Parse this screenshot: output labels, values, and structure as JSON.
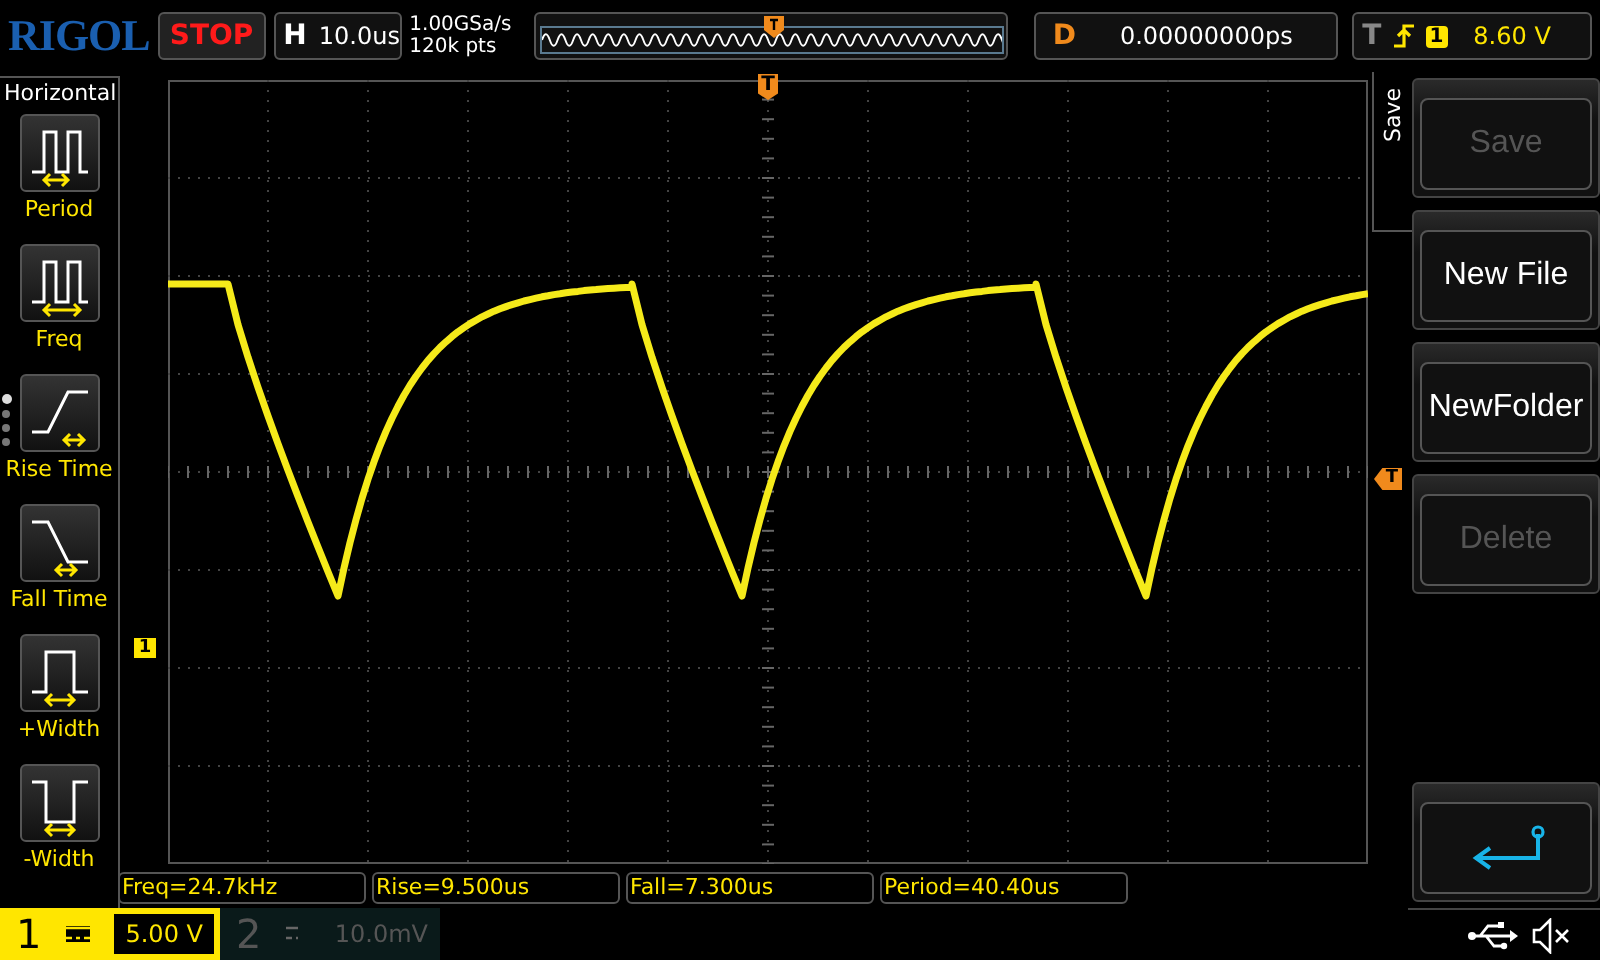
{
  "header": {
    "logo": "RIGOL",
    "run_state": "STOP",
    "timebase": {
      "label": "H",
      "value": "10.0us"
    },
    "sample_rate": "1.00GSa/s",
    "memory_depth": "120k pts",
    "delay": {
      "label": "D",
      "value": "0.00000000ps"
    },
    "trigger": {
      "label": "T",
      "channel": "1",
      "level_text": "8.60 V"
    }
  },
  "left_menu": {
    "title": "Horizontal",
    "items": [
      {
        "kind": "period",
        "label": "Period"
      },
      {
        "kind": "freq",
        "label": "Freq"
      },
      {
        "kind": "rise",
        "label": "Rise Time"
      },
      {
        "kind": "fall",
        "label": "Fall Time"
      },
      {
        "kind": "pwidth",
        "label": "+Width"
      },
      {
        "kind": "nwidth",
        "label": "-Width"
      }
    ]
  },
  "markers": {
    "trigger_top": "T",
    "trigger_level": "T",
    "channel": "1"
  },
  "right_menu": {
    "title": "Save",
    "buttons": [
      {
        "kind": "text",
        "label": "Save",
        "disabled": true
      },
      {
        "kind": "text",
        "label": "New File",
        "disabled": false
      },
      {
        "kind": "text",
        "label": "NewFolder",
        "disabled": false
      },
      {
        "kind": "text",
        "label": "Delete",
        "disabled": true
      },
      {
        "kind": "back",
        "disabled": false
      }
    ]
  },
  "measurements": [
    "Freq=24.7kHz",
    "Rise=9.500us",
    "Fall=7.300us",
    "Period=40.40us"
  ],
  "channels": [
    {
      "number": "1",
      "scale": "5.00 V",
      "selected": true
    },
    {
      "number": "2",
      "scale": "10.0mV",
      "selected": false
    }
  ]
}
